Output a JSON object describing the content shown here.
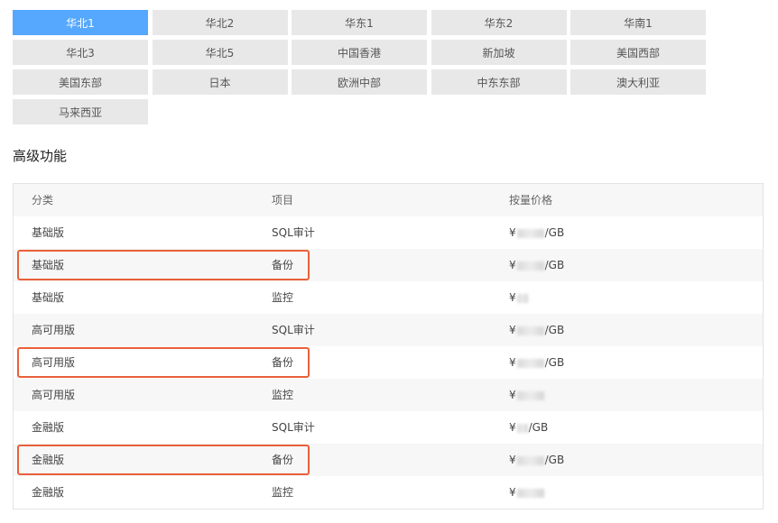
{
  "regions": [
    {
      "label": "华北1",
      "active": true
    },
    {
      "label": "华北2"
    },
    {
      "label": "华东1"
    },
    {
      "label": "华东2"
    },
    {
      "label": "华南1"
    },
    {
      "label": "华北3"
    },
    {
      "label": "华北5"
    },
    {
      "label": "中国香港"
    },
    {
      "label": "新加坡"
    },
    {
      "label": "美国西部"
    },
    {
      "label": "美国东部"
    },
    {
      "label": "日本"
    },
    {
      "label": "欧洲中部"
    },
    {
      "label": "中东东部"
    },
    {
      "label": "澳大利亚"
    },
    {
      "label": "马来西亚"
    }
  ],
  "section_title": "高级功能",
  "table": {
    "headers": {
      "category": "分类",
      "item": "项目",
      "price": "按量价格"
    },
    "rows": [
      {
        "category": "基础版",
        "item": "SQL审计",
        "price_prefix": "¥",
        "price_suffix": "/GB"
      },
      {
        "category": "基础版",
        "item": "备份",
        "price_prefix": "¥",
        "price_suffix": "/GB",
        "highlighted": true
      },
      {
        "category": "基础版",
        "item": "监控",
        "price_prefix": "¥",
        "price_suffix": ""
      },
      {
        "category": "高可用版",
        "item": "SQL审计",
        "price_prefix": "¥",
        "price_suffix": "/GB"
      },
      {
        "category": "高可用版",
        "item": "备份",
        "price_prefix": "¥",
        "price_suffix": "/GB",
        "highlighted": true
      },
      {
        "category": "高可用版",
        "item": "监控",
        "price_prefix": "¥",
        "price_suffix": ""
      },
      {
        "category": "金融版",
        "item": "SQL审计",
        "price_prefix": "¥",
        "price_suffix": "/GB"
      },
      {
        "category": "金融版",
        "item": "备份",
        "price_prefix": "¥",
        "price_suffix": "/GB",
        "highlighted": true
      },
      {
        "category": "金融版",
        "item": "监控",
        "price_prefix": "¥",
        "price_suffix": ""
      }
    ]
  },
  "colors": {
    "active_tab": "#55a8fd",
    "highlight": "#e9603a"
  }
}
